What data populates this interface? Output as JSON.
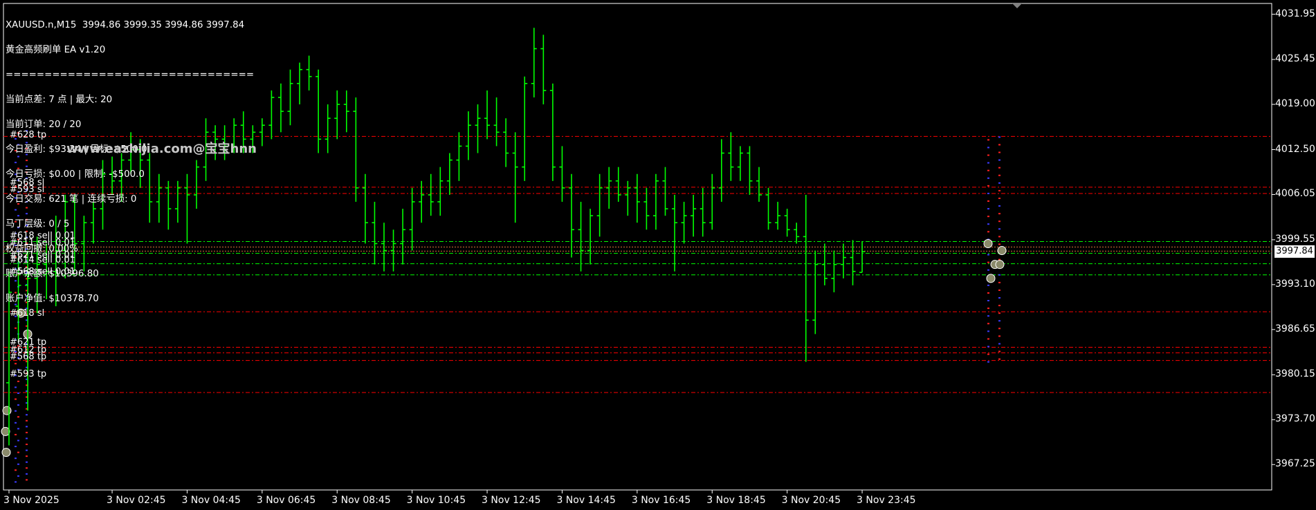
{
  "header": {
    "symbol_line": "XAUUSD.n,M15  3994.86 3999.35 3994.86 3997.84",
    "ea_name": "黄金高频刷单 EA v1.20",
    "separator": "================================",
    "lines": [
      "当前点差: 7 点 | 最大: 20",
      "当前订单: 20 / 20",
      "今日盈利: $93.34 | 目标: $500.0",
      "今日亏损: $0.00 | 限制: -$500.0",
      "今日交易: 621 笔 | 连续亏损: 0",
      "马丁层级: 0 / 5",
      "权益回撤: 0.00%",
      "账户余额: $10396.80",
      "账户净值: $10378.70"
    ]
  },
  "watermark": "www.eazhijia.com@宝宝hnn",
  "current_price_label": "3997.84",
  "colors": {
    "background": "#000000",
    "candle": "#00ff00",
    "sl_tp_line": "#ff0000",
    "sell_line": "#00ff00",
    "axis": "#ffffff",
    "buy_marker": "#3b3bff",
    "sell_marker": "#ff2020"
  },
  "order_labels": [
    {
      "text": "#628 tp",
      "price": 4014.4
    },
    {
      "text": "#568 sl",
      "price": 4007.6
    },
    {
      "text": "#593 sl",
      "price": 4006.6
    },
    {
      "text": "#618 sell 0.01",
      "price": 3999.9
    },
    {
      "text": "#611 sell 0.01",
      "price": 3998.9
    },
    {
      "text": "#621 sell 0.01",
      "price": 3997.2
    },
    {
      "text": "#614 sell 0.01",
      "price": 3996.5
    },
    {
      "text": "#568 sell 0.01",
      "price": 3994.8
    },
    {
      "text": "#618 sl",
      "price": 3988.8
    },
    {
      "text": "#621 tp",
      "price": 3984.6
    },
    {
      "text": "#612 tp",
      "price": 3983.6
    },
    {
      "text": "#568 tp",
      "price": 3982.6
    },
    {
      "text": "#593 tp",
      "price": 3980.1
    }
  ],
  "chart_data": {
    "type": "ohlc",
    "title": "XAUUSD.n,M15",
    "ylim": [
      3962.5,
      4035.0
    ],
    "yticks": [
      4031.95,
      4025.45,
      4019.0,
      4012.5,
      4006.05,
      3999.55,
      3993.1,
      3986.65,
      3980.15,
      3973.7,
      3967.25
    ],
    "ytick_labels": [
      "4031.95",
      "4025.45",
      "4019.00",
      "4012.50",
      "4006.05",
      "3999.55",
      "3993.10",
      "3986.65",
      "3980.15",
      "3973.70",
      "3967.25"
    ],
    "xtick_labels": [
      "3 Nov 2025",
      "3 Nov 02:45",
      "3 Nov 04:45",
      "3 Nov 06:45",
      "3 Nov 08:45",
      "3 Nov 10:45",
      "3 Nov 12:45",
      "3 Nov 14:45",
      "3 Nov 16:45",
      "3 Nov 18:45",
      "3 Nov 20:45",
      "3 Nov 23:45"
    ],
    "xtick_bar_index": [
      0,
      11,
      19,
      27,
      35,
      43,
      51,
      59,
      67,
      75,
      83,
      91
    ],
    "horizontal_levels": {
      "red_dashdot": [
        4014.4,
        4007.1,
        4006.2,
        3989.2,
        3984.1,
        3983.3,
        3982.2,
        3977.6
      ],
      "green_dashdot": [
        3999.3,
        3997.6,
        3996.1,
        3994.5
      ],
      "brown_dotted": [
        3998.5,
        3997.9
      ]
    },
    "bars": [
      [
        3979.0,
        3995.0,
        3970.0,
        3992.0
      ],
      [
        3990.0,
        3997.0,
        3985.0,
        3993.0
      ],
      [
        3993.0,
        3998.0,
        3975.0,
        3994.0
      ],
      [
        3994.0,
        4000.0,
        3989.0,
        3996.0
      ],
      [
        3996.0,
        3999.0,
        3991.0,
        3995.0
      ],
      [
        3995.0,
        4003.0,
        3990.0,
        3998.0
      ],
      [
        3998.0,
        4006.0,
        3994.0,
        4005.0
      ],
      [
        4005.0,
        4006.0,
        3995.0,
        3999.0
      ],
      [
        3999.0,
        4003.0,
        3995.0,
        4002.0
      ],
      [
        4002.0,
        4005.0,
        3999.0,
        4004.0
      ],
      [
        4004.0,
        4011.0,
        4001.0,
        4009.0
      ],
      [
        4009.0,
        4011.5,
        4006.0,
        4008.0
      ],
      [
        4008.0,
        4012.0,
        4005.0,
        4011.0
      ],
      [
        4011.0,
        4015.0,
        4009.0,
        4012.5
      ],
      [
        4012.5,
        4014.0,
        4007.0,
        4011.0
      ],
      [
        4011.0,
        4012.0,
        4002.0,
        4005.0
      ],
      [
        4005.0,
        4009.0,
        4002.0,
        4007.0
      ],
      [
        4007.0,
        4008.0,
        4001.0,
        4004.0
      ],
      [
        4004.0,
        4008.0,
        4002.0,
        4007.0
      ],
      [
        4007.0,
        4009.0,
        3999.0,
        4006.0
      ],
      [
        4006.0,
        4011.0,
        4004.0,
        4010.0
      ],
      [
        4010.0,
        4017.0,
        4008.0,
        4015.0
      ],
      [
        4015.0,
        4016.0,
        4011.0,
        4014.0
      ],
      [
        4014.0,
        4016.0,
        4011.0,
        4013.0
      ],
      [
        4013.0,
        4017.0,
        4012.0,
        4016.0
      ],
      [
        4016.0,
        4018.0,
        4012.0,
        4014.0
      ],
      [
        4014.0,
        4016.0,
        4012.0,
        4015.0
      ],
      [
        4015.0,
        4017.0,
        4013.0,
        4016.0
      ],
      [
        4016.0,
        4021.0,
        4014.0,
        4020.0
      ],
      [
        4020.0,
        4022.0,
        4015.0,
        4018.0
      ],
      [
        4018.0,
        4024.0,
        4016.0,
        4022.0
      ],
      [
        4022.0,
        4025.0,
        4019.0,
        4024.0
      ],
      [
        4024.0,
        4026.0,
        4021.0,
        4023.0
      ],
      [
        4023.0,
        4024.0,
        4012.0,
        4014.0
      ],
      [
        4014.0,
        4019.0,
        4012.0,
        4017.0
      ],
      [
        4017.0,
        4021.0,
        4014.0,
        4019.0
      ],
      [
        4019.0,
        4021.0,
        4015.0,
        4018.0
      ],
      [
        4018.0,
        4020.0,
        4005.0,
        4007.0
      ],
      [
        4007.0,
        4009.0,
        3999.0,
        4002.0
      ],
      [
        4002.0,
        4005.0,
        3996.0,
        3999.0
      ],
      [
        3999.0,
        4002.0,
        3995.0,
        3998.0
      ],
      [
        3998.0,
        4001.0,
        3995.0,
        3999.0
      ],
      [
        3999.0,
        4004.0,
        3996.0,
        4001.0
      ],
      [
        4001.0,
        4007.0,
        3998.0,
        4005.0
      ],
      [
        4005.0,
        4008.0,
        4002.0,
        4006.0
      ],
      [
        4006.0,
        4009.0,
        4003.0,
        4005.0
      ],
      [
        4005.0,
        4010.0,
        4003.0,
        4008.0
      ],
      [
        4008.0,
        4012.0,
        4006.0,
        4011.0
      ],
      [
        4011.0,
        4015.0,
        4008.0,
        4013.0
      ],
      [
        4013.0,
        4018.0,
        4011.0,
        4016.0
      ],
      [
        4016.0,
        4019.0,
        4012.0,
        4017.0
      ],
      [
        4017.0,
        4021.0,
        4014.0,
        4016.0
      ],
      [
        4016.0,
        4020.0,
        4013.0,
        4015.0
      ],
      [
        4015.0,
        4017.0,
        4010.0,
        4012.0
      ],
      [
        4012.0,
        4015.0,
        4002.0,
        4010.0
      ],
      [
        4010.0,
        4023.0,
        4008.0,
        4022.0
      ],
      [
        4022.0,
        4030.0,
        4020.0,
        4027.0
      ],
      [
        4027.0,
        4029.0,
        4019.0,
        4021.0
      ],
      [
        4021.0,
        4022.0,
        4008.0,
        4010.0
      ],
      [
        4010.0,
        4013.0,
        4005.0,
        4007.0
      ],
      [
        4007.0,
        4009.0,
        3997.0,
        4001.0
      ],
      [
        4001.0,
        4005.0,
        3995.0,
        3998.0
      ],
      [
        3998.0,
        4004.0,
        3996.0,
        4003.0
      ],
      [
        4003.0,
        4009.0,
        4000.0,
        4007.0
      ],
      [
        4007.0,
        4010.0,
        4004.0,
        4008.0
      ],
      [
        4008.0,
        4010.0,
        4005.0,
        4006.0
      ],
      [
        4006.0,
        4008.0,
        4003.0,
        4007.0
      ],
      [
        4007.0,
        4009.0,
        4002.0,
        4005.0
      ],
      [
        4005.0,
        4007.0,
        4001.0,
        4003.0
      ],
      [
        4003.0,
        4009.0,
        4001.0,
        4008.0
      ],
      [
        4008.0,
        4010.0,
        4003.0,
        4004.0
      ],
      [
        4004.0,
        4006.0,
        3995.0,
        4002.0
      ],
      [
        4002.0,
        4005.0,
        3999.0,
        4003.0
      ],
      [
        4003.0,
        4006.0,
        4000.0,
        4004.0
      ],
      [
        4004.0,
        4007.0,
        4000.0,
        4002.0
      ],
      [
        4002.0,
        4009.0,
        4001.0,
        4007.0
      ],
      [
        4007.0,
        4014.0,
        4005.0,
        4012.0
      ],
      [
        4012.0,
        4015.0,
        4008.0,
        4010.0
      ],
      [
        4010.0,
        4013.0,
        4008.0,
        4012.0
      ],
      [
        4012.0,
        4013.0,
        4006.0,
        4008.0
      ],
      [
        4008.0,
        4010.0,
        4005.0,
        4006.0
      ],
      [
        4006.0,
        4007.0,
        4001.0,
        4002.0
      ],
      [
        4002.0,
        4005.0,
        4001.0,
        4003.0
      ],
      [
        4003.0,
        4004.0,
        4000.0,
        4001.0
      ],
      [
        4001.0,
        4002.0,
        3999.0,
        4000.0
      ],
      [
        4000.0,
        4006.0,
        3982.0,
        3988.0
      ],
      [
        3988.0,
        3998.0,
        3986.0,
        3996.0
      ],
      [
        3996.0,
        3999.0,
        3993.0,
        3994.0
      ],
      [
        3994.0,
        3998.0,
        3992.0,
        3996.0
      ],
      [
        3996.0,
        3999.0,
        3994.0,
        3997.0
      ],
      [
        3997.0,
        3999.5,
        3993.0,
        3995.0
      ],
      [
        3994.86,
        3999.35,
        3994.86,
        3997.84
      ]
    ]
  }
}
